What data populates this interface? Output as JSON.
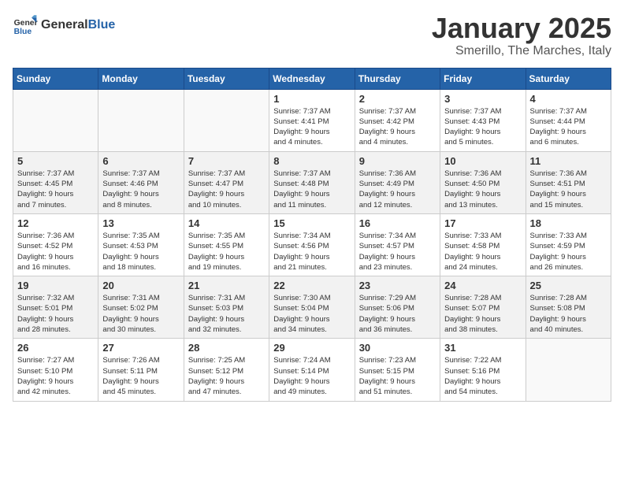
{
  "header": {
    "logo_general": "General",
    "logo_blue": "Blue",
    "title": "January 2025",
    "subtitle": "Smerillo, The Marches, Italy"
  },
  "weekdays": [
    "Sunday",
    "Monday",
    "Tuesday",
    "Wednesday",
    "Thursday",
    "Friday",
    "Saturday"
  ],
  "weeks": [
    {
      "row_class": "odd-row",
      "days": [
        {
          "num": "",
          "info": ""
        },
        {
          "num": "",
          "info": ""
        },
        {
          "num": "",
          "info": ""
        },
        {
          "num": "1",
          "info": "Sunrise: 7:37 AM\nSunset: 4:41 PM\nDaylight: 9 hours\nand 4 minutes."
        },
        {
          "num": "2",
          "info": "Sunrise: 7:37 AM\nSunset: 4:42 PM\nDaylight: 9 hours\nand 4 minutes."
        },
        {
          "num": "3",
          "info": "Sunrise: 7:37 AM\nSunset: 4:43 PM\nDaylight: 9 hours\nand 5 minutes."
        },
        {
          "num": "4",
          "info": "Sunrise: 7:37 AM\nSunset: 4:44 PM\nDaylight: 9 hours\nand 6 minutes."
        }
      ]
    },
    {
      "row_class": "even-row",
      "days": [
        {
          "num": "5",
          "info": "Sunrise: 7:37 AM\nSunset: 4:45 PM\nDaylight: 9 hours\nand 7 minutes."
        },
        {
          "num": "6",
          "info": "Sunrise: 7:37 AM\nSunset: 4:46 PM\nDaylight: 9 hours\nand 8 minutes."
        },
        {
          "num": "7",
          "info": "Sunrise: 7:37 AM\nSunset: 4:47 PM\nDaylight: 9 hours\nand 10 minutes."
        },
        {
          "num": "8",
          "info": "Sunrise: 7:37 AM\nSunset: 4:48 PM\nDaylight: 9 hours\nand 11 minutes."
        },
        {
          "num": "9",
          "info": "Sunrise: 7:36 AM\nSunset: 4:49 PM\nDaylight: 9 hours\nand 12 minutes."
        },
        {
          "num": "10",
          "info": "Sunrise: 7:36 AM\nSunset: 4:50 PM\nDaylight: 9 hours\nand 13 minutes."
        },
        {
          "num": "11",
          "info": "Sunrise: 7:36 AM\nSunset: 4:51 PM\nDaylight: 9 hours\nand 15 minutes."
        }
      ]
    },
    {
      "row_class": "odd-row",
      "days": [
        {
          "num": "12",
          "info": "Sunrise: 7:36 AM\nSunset: 4:52 PM\nDaylight: 9 hours\nand 16 minutes."
        },
        {
          "num": "13",
          "info": "Sunrise: 7:35 AM\nSunset: 4:53 PM\nDaylight: 9 hours\nand 18 minutes."
        },
        {
          "num": "14",
          "info": "Sunrise: 7:35 AM\nSunset: 4:55 PM\nDaylight: 9 hours\nand 19 minutes."
        },
        {
          "num": "15",
          "info": "Sunrise: 7:34 AM\nSunset: 4:56 PM\nDaylight: 9 hours\nand 21 minutes."
        },
        {
          "num": "16",
          "info": "Sunrise: 7:34 AM\nSunset: 4:57 PM\nDaylight: 9 hours\nand 23 minutes."
        },
        {
          "num": "17",
          "info": "Sunrise: 7:33 AM\nSunset: 4:58 PM\nDaylight: 9 hours\nand 24 minutes."
        },
        {
          "num": "18",
          "info": "Sunrise: 7:33 AM\nSunset: 4:59 PM\nDaylight: 9 hours\nand 26 minutes."
        }
      ]
    },
    {
      "row_class": "even-row",
      "days": [
        {
          "num": "19",
          "info": "Sunrise: 7:32 AM\nSunset: 5:01 PM\nDaylight: 9 hours\nand 28 minutes."
        },
        {
          "num": "20",
          "info": "Sunrise: 7:31 AM\nSunset: 5:02 PM\nDaylight: 9 hours\nand 30 minutes."
        },
        {
          "num": "21",
          "info": "Sunrise: 7:31 AM\nSunset: 5:03 PM\nDaylight: 9 hours\nand 32 minutes."
        },
        {
          "num": "22",
          "info": "Sunrise: 7:30 AM\nSunset: 5:04 PM\nDaylight: 9 hours\nand 34 minutes."
        },
        {
          "num": "23",
          "info": "Sunrise: 7:29 AM\nSunset: 5:06 PM\nDaylight: 9 hours\nand 36 minutes."
        },
        {
          "num": "24",
          "info": "Sunrise: 7:28 AM\nSunset: 5:07 PM\nDaylight: 9 hours\nand 38 minutes."
        },
        {
          "num": "25",
          "info": "Sunrise: 7:28 AM\nSunset: 5:08 PM\nDaylight: 9 hours\nand 40 minutes."
        }
      ]
    },
    {
      "row_class": "odd-row",
      "days": [
        {
          "num": "26",
          "info": "Sunrise: 7:27 AM\nSunset: 5:10 PM\nDaylight: 9 hours\nand 42 minutes."
        },
        {
          "num": "27",
          "info": "Sunrise: 7:26 AM\nSunset: 5:11 PM\nDaylight: 9 hours\nand 45 minutes."
        },
        {
          "num": "28",
          "info": "Sunrise: 7:25 AM\nSunset: 5:12 PM\nDaylight: 9 hours\nand 47 minutes."
        },
        {
          "num": "29",
          "info": "Sunrise: 7:24 AM\nSunset: 5:14 PM\nDaylight: 9 hours\nand 49 minutes."
        },
        {
          "num": "30",
          "info": "Sunrise: 7:23 AM\nSunset: 5:15 PM\nDaylight: 9 hours\nand 51 minutes."
        },
        {
          "num": "31",
          "info": "Sunrise: 7:22 AM\nSunset: 5:16 PM\nDaylight: 9 hours\nand 54 minutes."
        },
        {
          "num": "",
          "info": ""
        }
      ]
    }
  ]
}
